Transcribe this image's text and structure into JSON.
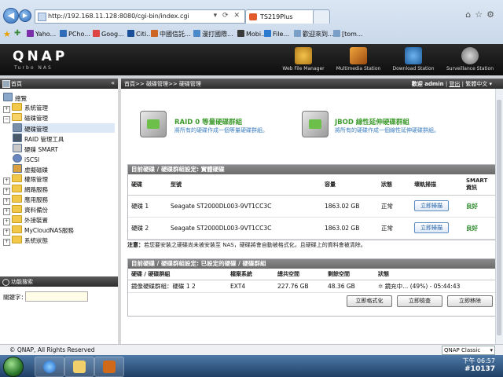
{
  "browser": {
    "address": "http://192.168.11.128:8080/cgi-bin/index.cgi",
    "tabs": [
      {
        "label": "192.168.11.128"
      },
      {
        "label": "TS219Plus"
      }
    ],
    "favorites": [
      "Yaho...",
      "PCho...",
      "Goog...",
      "Citi...",
      "中國信託...",
      "漫打國際...",
      "Mobi...",
      "File...",
      "歡迎來到...",
      "[tom..."
    ]
  },
  "qnap": {
    "logo": "QNAP",
    "logo_sub": "Turbo NAS",
    "apps": [
      "Web File Manager",
      "Multimedia Station",
      "Download Station",
      "Surveillance Station"
    ]
  },
  "sidebar": {
    "title": "首頁",
    "items": [
      {
        "label": "總覽",
        "level": 1,
        "type": "leaf"
      },
      {
        "label": "系統管理",
        "level": 1,
        "type": "folder"
      },
      {
        "label": "磁碟管理",
        "level": 1,
        "type": "folder-open"
      },
      {
        "label": "硬碟管理",
        "level": 2,
        "type": "leaf"
      },
      {
        "label": "RAID 管理工具",
        "level": 2,
        "type": "leaf"
      },
      {
        "label": "硬碟 SMART",
        "level": 2,
        "type": "leaf"
      },
      {
        "label": "iSCSI",
        "level": 2,
        "type": "leaf"
      },
      {
        "label": "虛擬磁碟",
        "level": 2,
        "type": "leaf"
      },
      {
        "label": "權限管理",
        "level": 1,
        "type": "folder"
      },
      {
        "label": "網路服務",
        "level": 1,
        "type": "folder"
      },
      {
        "label": "應用服務",
        "level": 1,
        "type": "folder"
      },
      {
        "label": "資料備份",
        "level": 1,
        "type": "folder"
      },
      {
        "label": "外接裝置",
        "level": 1,
        "type": "folder"
      },
      {
        "label": "MyCloudNAS服務",
        "level": 1,
        "type": "folder"
      },
      {
        "label": "系統狀態",
        "level": 1,
        "type": "folder"
      }
    ],
    "search_title": "功能搜索",
    "keyword_label": "關鍵字："
  },
  "main": {
    "breadcrumb": "首頁>> 磁碟管理>> 硬碟管理",
    "welcome": "歡迎 admin",
    "logout": "登出",
    "language": "繁體中文",
    "options": [
      {
        "title": "RAID 0 等量硬碟群組",
        "desc": "將所有的硬碟作成一個等量硬碟群組。"
      },
      {
        "title": "JBOD 線性延伸硬碟群組",
        "desc": "將所有的硬碟作成一個線性延伸硬碟群組。"
      }
    ],
    "physical": {
      "title": "目前硬碟 / 硬碟群組設定: 實體硬碟",
      "headers": [
        "硬碟",
        "型號",
        "容量",
        "狀態",
        "壞軌掃描",
        "SMART 資訊"
      ],
      "rows": [
        {
          "disk": "硬碟 1",
          "model": "Seagate ST2000DL003-9VT1CC3C",
          "capacity": "1863.02 GB",
          "status": "正常",
          "scan": "立即掃描",
          "smart": "良好"
        },
        {
          "disk": "硬碟 2",
          "model": "Seagate ST2000DL003-9VT1CC3C",
          "capacity": "1863.02 GB",
          "status": "正常",
          "scan": "立即掃描",
          "smart": "良好"
        }
      ]
    },
    "note_label": "注意：",
    "note_text": "若您要安裝之硬碟尚未被安裝至 NAS，硬碟將會自動被格式化，且硬碟上的資料會被清除。",
    "configured": {
      "title": "目前硬碟 / 硬碟群組設定: 已設定的硬碟 / 硬碟群組",
      "headers": [
        "硬碟 / 硬碟群組",
        "檔案系統",
        "總共空間",
        "剩餘空間",
        "狀態"
      ],
      "row": {
        "name": "鏡像硬碟群組：硬碟 1 2",
        "fs": "EXT4",
        "total": "227.76 GB",
        "free": "48.36 GB",
        "status": "鏡充中... (49%) - 05:44:43",
        "progress_pct": 49
      }
    },
    "actions": [
      "立即格式化",
      "立即檢查",
      "立即移除"
    ]
  },
  "status": {
    "copyright": "© QNAP, All Rights Reserved",
    "theme": "QNAP Classic"
  },
  "taskbar": {
    "time": "下午 06:57",
    "watermark": "#10137"
  },
  "colors": {
    "accent_green": "#3c9a2c",
    "link_blue": "#3c7fc0",
    "ok_green": "#2a8a2a"
  }
}
